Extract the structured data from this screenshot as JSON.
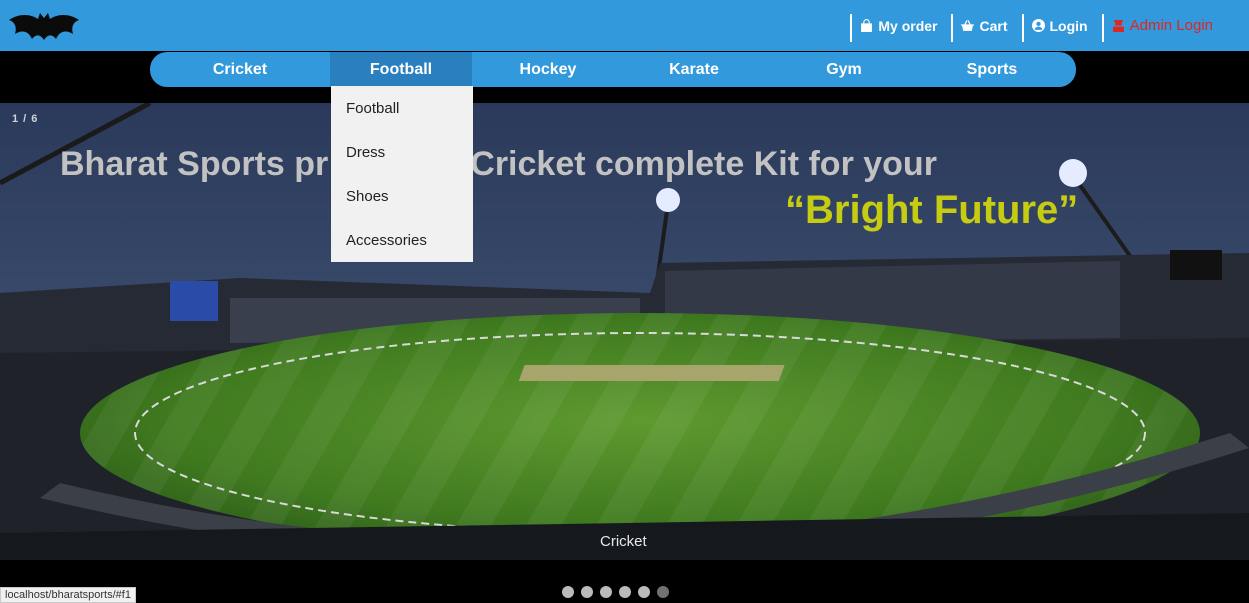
{
  "header": {
    "links": [
      {
        "label": "My order",
        "icon": "shopping-bag-icon"
      },
      {
        "label": "Cart",
        "icon": "shopping-basket-icon"
      },
      {
        "label": "Login",
        "icon": "user-circle-icon"
      },
      {
        "label": "Admin Login",
        "icon": "admin-user-icon"
      }
    ]
  },
  "nav": {
    "items": [
      "Cricket",
      "Football",
      "Hockey",
      "Karate",
      "Gym",
      "Sports"
    ],
    "active": "Football"
  },
  "dropdown": {
    "items": [
      "Football",
      "Dress",
      "Shoes",
      "Accessories"
    ]
  },
  "slideshow": {
    "counter": "1 / 6",
    "headline_left": "Bharat Sports pr",
    "headline_right": "Cricket complete Kit for your",
    "headline2": "“Bright Future”",
    "caption": "Cricket",
    "dot_count": 6
  },
  "status_url": "localhost/bharatsports/#f1",
  "colors": {
    "header_blue": "#3399dd",
    "active_nav": "#2a7fbf",
    "headline_yellow": "#c6cc12",
    "admin_red": "#e0261f"
  }
}
